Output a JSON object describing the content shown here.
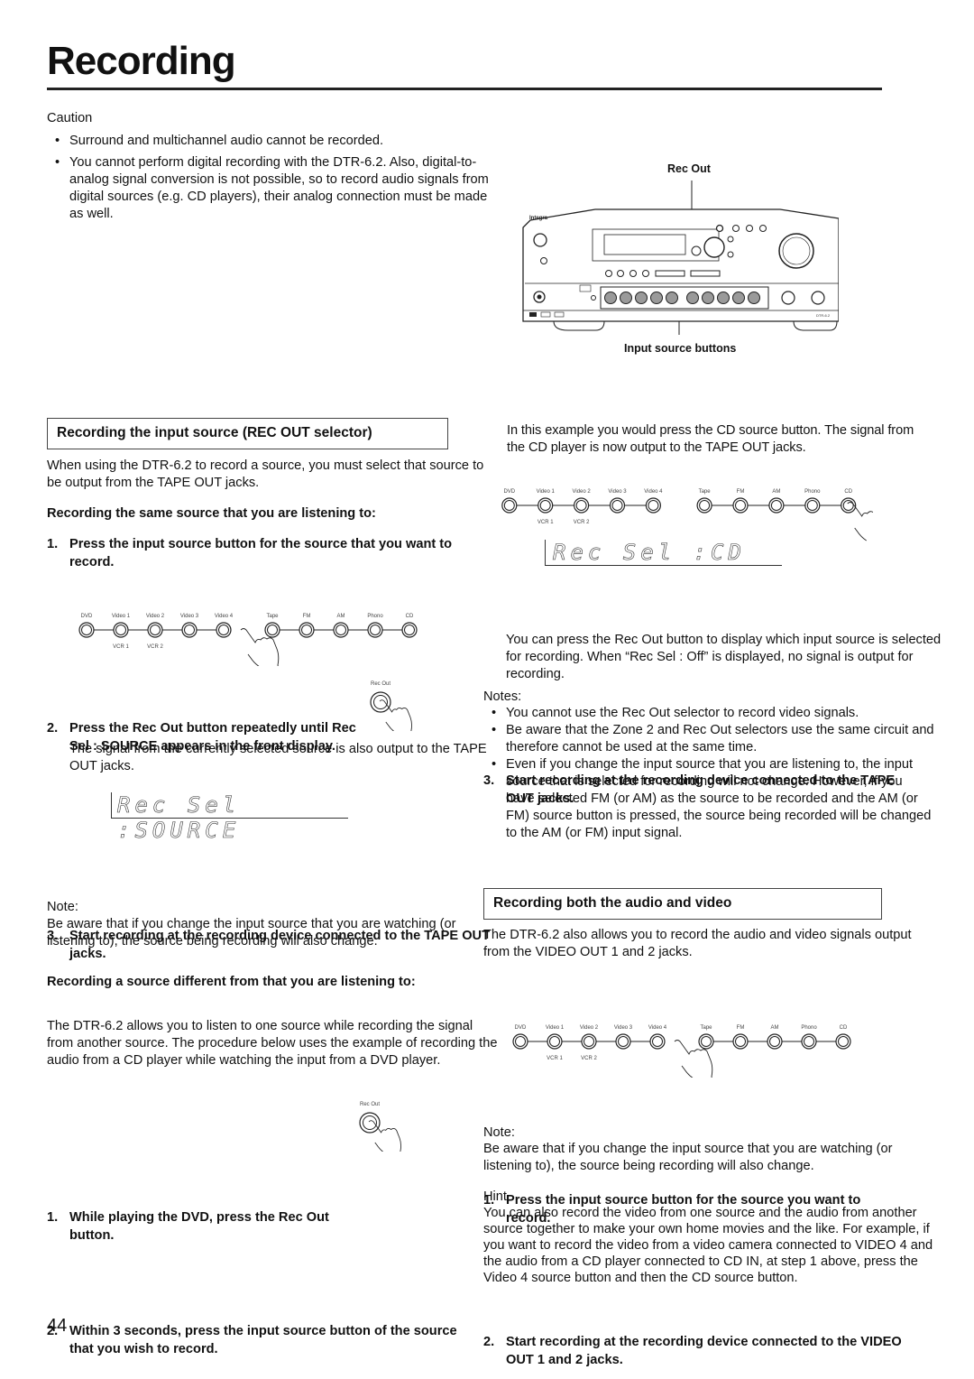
{
  "page": {
    "title": "Recording",
    "page_number": "44"
  },
  "caution": {
    "heading": "Caution",
    "items": [
      "Surround and multichannel audio cannot be recorded.",
      "You cannot perform digital recording with the DTR-6.2. Also, digital-to-analog signal conversion is not possible, so to record audio signals from digital sources (e.g. CD players), their analog connection must be made as well."
    ]
  },
  "receiver_figure": {
    "brand": "Integra",
    "model": "DTR-6.2",
    "callout_rec_out": "Rec Out",
    "callout_input_buttons": "Input source buttons"
  },
  "source_panel": {
    "top_labels": [
      "DVD",
      "Video 1",
      "Video 2",
      "Video 3",
      "Video 4",
      "Tape",
      "FM",
      "AM",
      "Phono",
      "CD"
    ],
    "bottom_labels": [
      "VCR 1",
      "VCR 2"
    ],
    "rec_out_label": "Rec Out"
  },
  "section1": {
    "heading": "Recording the input source (REC OUT selector)",
    "intro": "When using the DTR-6.2 to record a source, you must select that source to be output from the TAPE OUT jacks.",
    "subheading_same": "Recording the same source that you are listening to:",
    "step1": {
      "num": "1.",
      "text": "Press the input source button for the source that you want to record."
    },
    "step2": {
      "num": "2.",
      "text": "Press the Rec Out button repeatedly until   Rec Sel : SOURCE   appears in the front display.",
      "body": "The signal from the currently selected source is also output to the TAPE OUT jacks."
    },
    "lcd_source": "Rec Sel :SOURCE",
    "step3": {
      "num": "3.",
      "text": "Start recording at the recording device connected to the TAPE OUT jacks."
    },
    "note_heading": "Note:",
    "note_body": "Be aware that if you change the input source that you are watching (or listening to), the source being recording will also change.",
    "subheading_diff": "Recording a source different from that you are listening to:",
    "diff_intro": "The DTR-6.2 allows you to listen to one source while recording the signal from another source. The procedure below uses the example of recording the audio from a CD player while watching the input from a DVD player.",
    "diff_step1": {
      "num": "1.",
      "text": "While playing the DVD, press the Rec Out button."
    },
    "diff_step2": {
      "num": "2.",
      "text": "Within 3 seconds, press the input source button of the source that you wish to record."
    }
  },
  "right_col": {
    "example_text": "In this example you would press the CD source button. The signal from the CD player is now output to the TAPE OUT jacks.",
    "lcd_cd": "Rec Sel :CD",
    "step3": {
      "num": "3.",
      "text": "Start recording at the recording device connected to the TAPE OUT jacks.",
      "body": "You can press the Rec Out button to display which input source is selected for recording. When “Rec Sel : Off” is displayed, no signal is output for recording."
    },
    "notes_heading": "Notes:",
    "notes": [
      "You cannot use the Rec Out selector to record video signals.",
      "Be aware that the Zone 2 and Rec Out selectors use the same circuit and therefore cannot be used at the same time.",
      "Even if you change the input source that you are listening to, the input source that is selected for recording will not change. However, if you have selected FM (or AM) as the source to be recorded and the AM (or FM) source button is pressed, the source being recorded will be changed to the AM (or FM) input signal."
    ]
  },
  "section2": {
    "heading": "Recording both the audio and video",
    "intro": "The DTR-6.2 also allows you to record the audio and video signals output from the VIDEO OUT 1 and 2 jacks.",
    "step1": {
      "num": "1.",
      "text": "Press the input source button for the source you want to record."
    },
    "step2": {
      "num": "2.",
      "text": "Start recording at the recording device connected to the VIDEO OUT 1 and 2 jacks."
    },
    "note_heading": "Note:",
    "note_body": "Be aware that if you change the input source that you are watching (or listening to), the source being recording will also change.",
    "hint_heading": "Hint",
    "hint_body": "You can also record the video from one source and the audio from another source together to make your own home movies and the like. For example, if you want to record the video from a video camera connected to VIDEO 4 and the audio from a CD player connected to CD IN, at step 1 above, press the Video 4 source button and then the CD source button."
  }
}
